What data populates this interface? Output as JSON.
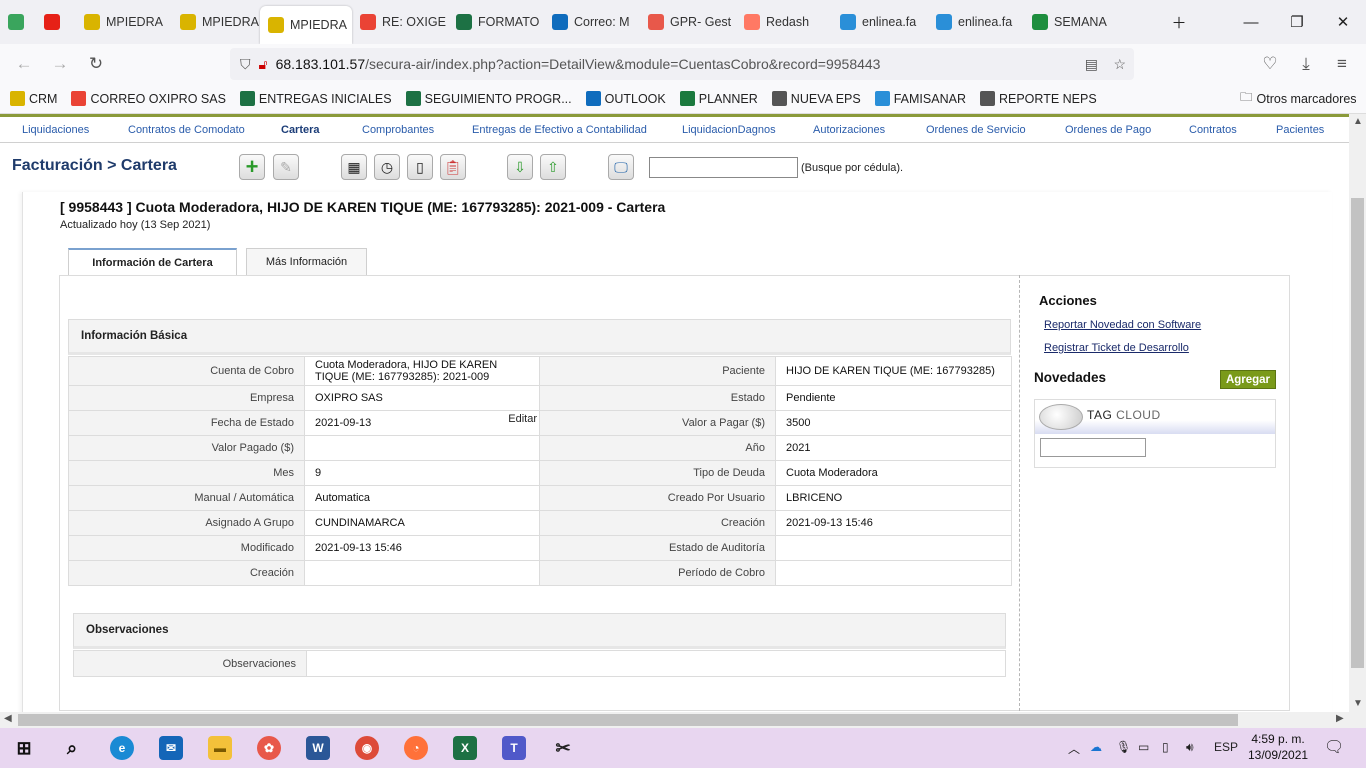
{
  "browser": {
    "tabs": [
      {
        "label": "",
        "icon": "badge-24-icon",
        "color": "#3aa55d"
      },
      {
        "label": "",
        "icon": "youtube-icon",
        "color": "#e62117"
      },
      {
        "label": "MPIEDRA",
        "icon": "paw-icon",
        "color": "#d9b400"
      },
      {
        "label": "MPIEDRA",
        "icon": "paw-icon",
        "color": "#d9b400"
      },
      {
        "label": "MPIEDRA",
        "icon": "paw-icon",
        "color": "#d9b400",
        "active": true
      },
      {
        "label": "RE: OXIGE",
        "icon": "gmail-icon",
        "color": "#ea4335"
      },
      {
        "label": "FORMATO",
        "icon": "excel-icon",
        "color": "#1d7144"
      },
      {
        "label": "Correo: M",
        "icon": "outlook-icon",
        "color": "#0f6cbd"
      },
      {
        "label": "GPR- Gest",
        "icon": "gpr-icon",
        "color": "#e8584a"
      },
      {
        "label": "Redash",
        "icon": "redash-icon",
        "color": "#ff7964"
      },
      {
        "label": "enlinea.fa",
        "icon": "famisanar-icon",
        "color": "#2a8fd8"
      },
      {
        "label": "enlinea.fa",
        "icon": "famisanar-icon",
        "color": "#2a8fd8"
      },
      {
        "label": "SEMANA",
        "icon": "sheets-icon",
        "color": "#1e8e3e"
      }
    ],
    "url_host": "68.183.101.57",
    "url_path": "/secura-air/index.php?action=DetailView&module=CuentasCobro&record=9958443",
    "bookmarks": [
      {
        "label": "CRM",
        "icon": "paw-icon",
        "color": "#d9b400"
      },
      {
        "label": "CORREO OXIPRO SAS",
        "icon": "gmail-icon",
        "color": "#ea4335"
      },
      {
        "label": "ENTREGAS INICIALES",
        "icon": "excel-icon",
        "color": "#1d7144"
      },
      {
        "label": "SEGUIMIENTO PROGR...",
        "icon": "excel-icon",
        "color": "#1d7144"
      },
      {
        "label": "OUTLOOK",
        "icon": "outlook-icon",
        "color": "#0f6cbd"
      },
      {
        "label": "PLANNER",
        "icon": "planner-icon",
        "color": "#1b7a3e"
      },
      {
        "label": "NUEVA EPS",
        "icon": "globe-icon",
        "color": "#555555"
      },
      {
        "label": "FAMISANAR",
        "icon": "famisanar-icon",
        "color": "#2a8fd8"
      },
      {
        "label": "REPORTE NEPS",
        "icon": "globe-icon",
        "color": "#555555"
      }
    ],
    "other_bookmarks": "Otros marcadores"
  },
  "modnav": [
    {
      "label": "Liquidaciones"
    },
    {
      "label": "Contratos de Comodato"
    },
    {
      "label": "Cartera",
      "current": true
    },
    {
      "label": "Comprobantes"
    },
    {
      "label": "Entregas de Efectivo a Contabilidad"
    },
    {
      "label": "LiquidacionDagnos"
    },
    {
      "label": "Autorizaciones"
    },
    {
      "label": "Ordenes de Servicio"
    },
    {
      "label": "Ordenes de Pago"
    },
    {
      "label": "Contratos"
    },
    {
      "label": "Pacientes"
    }
  ],
  "header": {
    "title": "Facturación > Cartera",
    "search_hint": "(Busque por cédula)."
  },
  "record": {
    "title": "[ 9958443 ] Cuota Moderadora, HIJO DE KAREN TIQUE (ME: 167793285): 2021-009 - Cartera",
    "updated": "Actualizado hoy (13 Sep 2021)"
  },
  "tabs": {
    "info": "Información de Cartera",
    "more": "Más Información"
  },
  "basic": {
    "heading": "Información Básica",
    "edit_label": "Editar",
    "rows": [
      {
        "l1": "Cuenta de Cobro",
        "v1": "Cuota Moderadora, HIJO DE KAREN TIQUE (ME: 167793285): 2021-009",
        "l2": "Paciente",
        "v2": "HIJO DE KAREN TIQUE (ME: 167793285)"
      },
      {
        "l1": "Empresa",
        "v1": "OXIPRO SAS",
        "l2": "Estado",
        "v2": "Pendiente"
      },
      {
        "l1": "Fecha de Estado",
        "v1": "2021-09-13",
        "l2": "Valor a Pagar ($)",
        "v2": "3500"
      },
      {
        "l1": "Valor Pagado ($)",
        "v1": "",
        "l2": "Año",
        "v2": "2021"
      },
      {
        "l1": "Mes",
        "v1": "9",
        "l2": "Tipo de Deuda",
        "v2": "Cuota Moderadora"
      },
      {
        "l1": "Manual / Automática",
        "v1": "Automatica",
        "l2": "Creado Por Usuario",
        "v2": "LBRICENO"
      },
      {
        "l1": "Asignado A Grupo",
        "v1": "CUNDINAMARCA",
        "l2": "Creación",
        "v2": "2021-09-13 15:46"
      },
      {
        "l1": "Modificado",
        "v1": "2021-09-13 15:46",
        "l2": "Estado de Auditoría",
        "v2": ""
      },
      {
        "l1": "Creación",
        "v1": "",
        "l2": "Período de Cobro",
        "v2": ""
      }
    ]
  },
  "observaciones": {
    "heading": "Observaciones",
    "label": "Observaciones",
    "value": ""
  },
  "side": {
    "acciones": "Acciones",
    "link1": "Reportar Novedad con Software",
    "link2": "Registrar Ticket de Desarrollo",
    "novedades": "Novedades",
    "agregar": "Agregar",
    "tag1": "TAG",
    "tag2": "CLOUD"
  },
  "taskbar": {
    "lang": "ESP",
    "time": "4:59 p. m.",
    "date": "13/09/2021"
  }
}
